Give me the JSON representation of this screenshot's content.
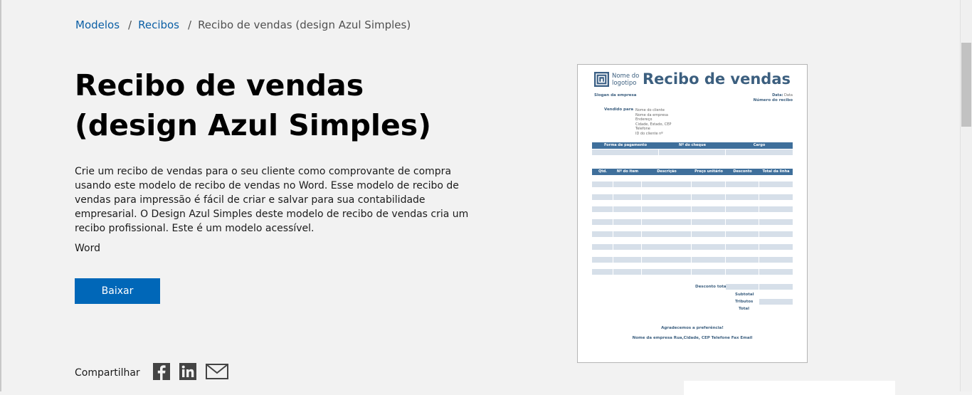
{
  "breadcrumb": {
    "item1": "Modelos",
    "item2": "Recibos",
    "separator": "/",
    "current": "Recibo de vendas (design Azul Simples)"
  },
  "title": "Recibo de vendas (design Azul Simples)",
  "description": "Crie um recibo de vendas para o seu cliente como comprovante de compra usando este modelo de recibo de vendas no Word. Esse modelo de recibo de vendas para impressão é fácil de criar e salvar para sua contabilidade empresarial. O Design Azul Simples deste modelo de recibo de vendas cria um recibo profissional. Este é um modelo acessível.",
  "app": "Word",
  "download_label": "Baixar",
  "share": {
    "label": "Compartilhar",
    "icons": [
      "facebook-icon",
      "linkedin-icon",
      "email-icon"
    ]
  },
  "preview": {
    "logo_name": "Nome do logotipo",
    "doc_title": "Recibo de vendas",
    "slogan": "Slogan da empresa",
    "date_label": "Data:",
    "date_value": "Data",
    "receipt_no": "Número do recibo",
    "sold_to": "Vendido para",
    "client_lines": [
      "Nome do cliente",
      "Nome da empresa",
      "Endereço",
      "Cidade, Estado, CEP",
      "Telefone",
      "ID do cliente nº"
    ],
    "payment_headers": [
      "Forma de pagamento",
      "Nº do cheque",
      "Cargo"
    ],
    "item_headers": [
      "Qtd.",
      "Nº do item",
      "Descrição",
      "Preço unitário",
      "Desconto",
      "Total da linha"
    ],
    "total_discount": "Desconto total",
    "subtotal": "Subtotal",
    "taxes": "Tributos",
    "total": "Total",
    "thanks": "Agradecemos a preferência!",
    "footer": "Nome da empresa  Rua,Cidade, CEP  Telefone  Fax  Email"
  },
  "colors": {
    "accent": "#0067b8",
    "link": "#0b5fa5",
    "doc_blue": "#3f6f9b",
    "row_fill": "#d6dfe9"
  }
}
